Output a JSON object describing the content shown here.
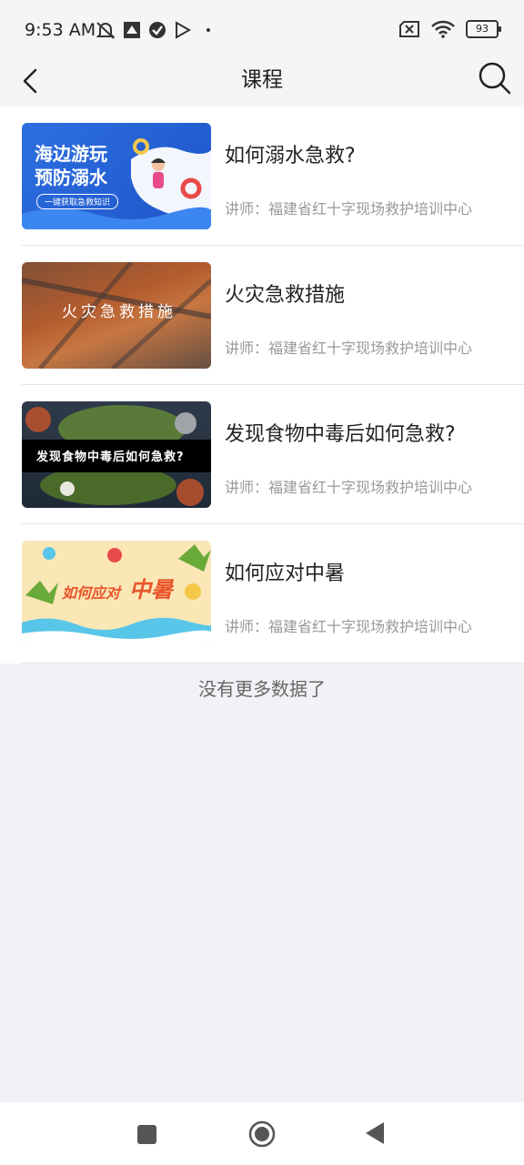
{
  "status": {
    "time": "9:53 AM",
    "battery": "93"
  },
  "header": {
    "title": "课程"
  },
  "courses": [
    {
      "title": "如何溺水急救?",
      "teacher": "讲师：福建省红十字现场救护培训中心",
      "thumb": {
        "line1": "海边游玩",
        "line2": "预防溺水",
        "tag": "一键获取急救知识"
      }
    },
    {
      "title": "火灾急救措施",
      "teacher": "讲师：福建省红十字现场救护培训中心",
      "thumb": {
        "text": "火灾急救措施"
      }
    },
    {
      "title": "发现食物中毒后如何急救?",
      "teacher": "讲师：福建省红十字现场救护培训中心",
      "thumb": {
        "text": "发现食物中毒后如何急救?"
      }
    },
    {
      "title": "如何应对中暑",
      "teacher": "讲师：福建省红十字现场救护培训中心",
      "thumb": {
        "text1": "如何应对",
        "text2": "中暑"
      }
    }
  ],
  "footer": {
    "no_more": "没有更多数据了"
  }
}
